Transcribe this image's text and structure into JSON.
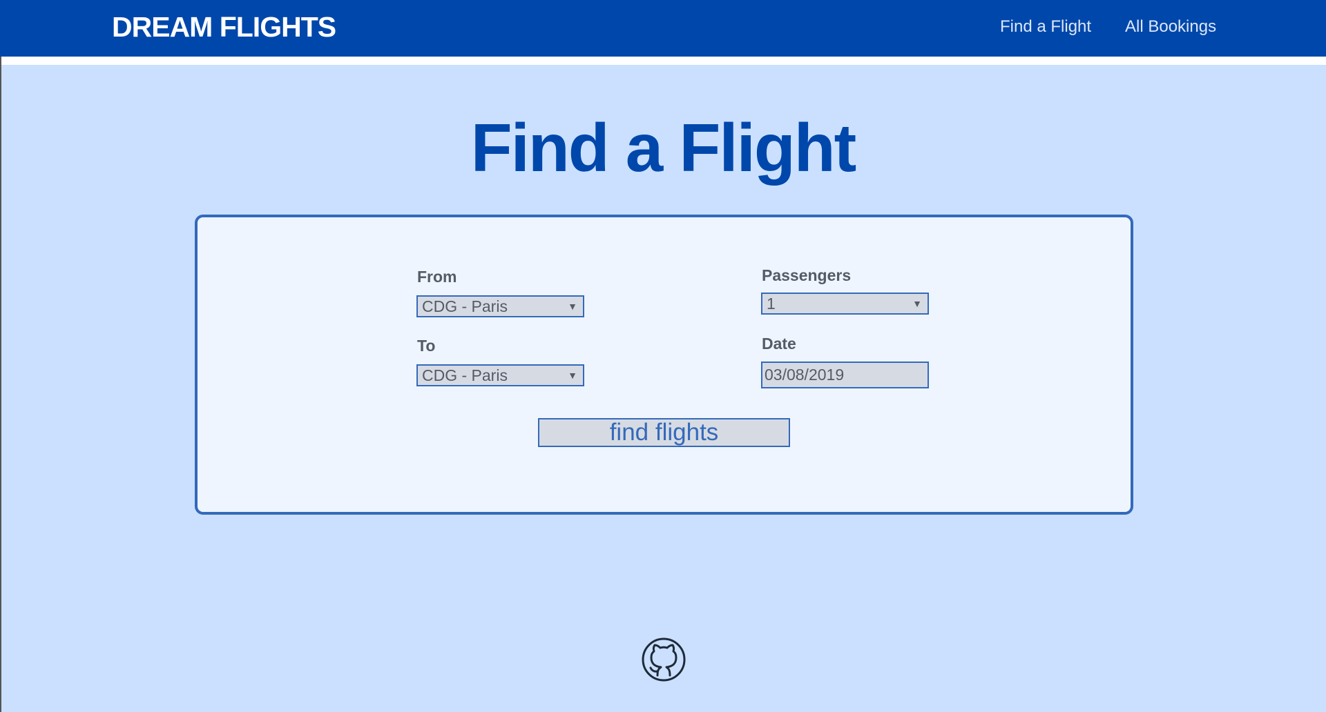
{
  "header": {
    "brand": "DREAM FLIGHTS",
    "nav": {
      "find_flight": "Find a Flight",
      "all_bookings": "All Bookings"
    }
  },
  "main": {
    "title": "Find a Flight",
    "form": {
      "from": {
        "label": "From",
        "value": "CDG - Paris"
      },
      "to": {
        "label": "To",
        "value": "CDG - Paris"
      },
      "passengers": {
        "label": "Passengers",
        "value": "1"
      },
      "date": {
        "label": "Date",
        "value": "03/08/2019"
      },
      "submit_label": "find flights"
    }
  },
  "footer": {
    "icon": "github-icon"
  },
  "colors": {
    "header_bg": "#0047ab",
    "page_bg": "#cae0fe",
    "card_bg": "#eef5fe",
    "accent": "#3469ba"
  }
}
